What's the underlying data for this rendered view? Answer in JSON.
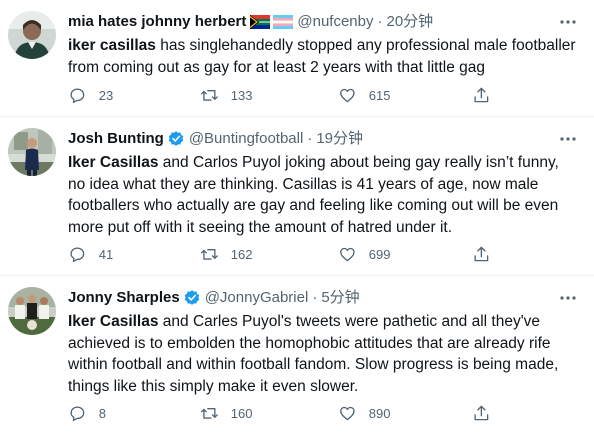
{
  "tweets": [
    {
      "name": "mia hates johnny herbert",
      "handle": "@nufcenby",
      "dot": "·",
      "time": "20分钟",
      "text_bold": "iker casillas",
      "text_rest": " has singlehandedly stopped any professional male footballer from coming out as gay for at least 2 years with that little gag",
      "reply_count": "23",
      "retweet_count": "133",
      "like_count": "615",
      "flags": [
        "south-africa-flag",
        "transgender-flag"
      ]
    },
    {
      "name": "Josh Bunting",
      "handle": "@Buntingfootball",
      "dot": "·",
      "time": "19分钟",
      "text_bold": "Iker Casillas",
      "text_rest": " and Carlos Puyol joking about being gay really isn’t funny, no idea what they are thinking. Casillas is 41 years of age, now male footballers who actually are gay and feeling like coming out will be even more put off with it seeing the amount of hatred under it.",
      "reply_count": "41",
      "retweet_count": "162",
      "like_count": "699",
      "verified": true
    },
    {
      "name": "Jonny Sharples",
      "handle": "@JonnyGabriel",
      "dot": "·",
      "time": "5分钟",
      "text_bold": "Iker Casillas",
      "text_rest": " and Carles Puyol's tweets were pathetic and all they've achieved is to embolden the homophobic attitudes that are already rife within football and within football fandom. Slow progress is being made, things like this simply make it even slower.",
      "reply_count": "8",
      "retweet_count": "160",
      "like_count": "890",
      "verified": true
    }
  ],
  "colors": {
    "secondary_text": "#536471",
    "verified_blue": "#1d9bf0",
    "divider": "#eff3f4"
  }
}
